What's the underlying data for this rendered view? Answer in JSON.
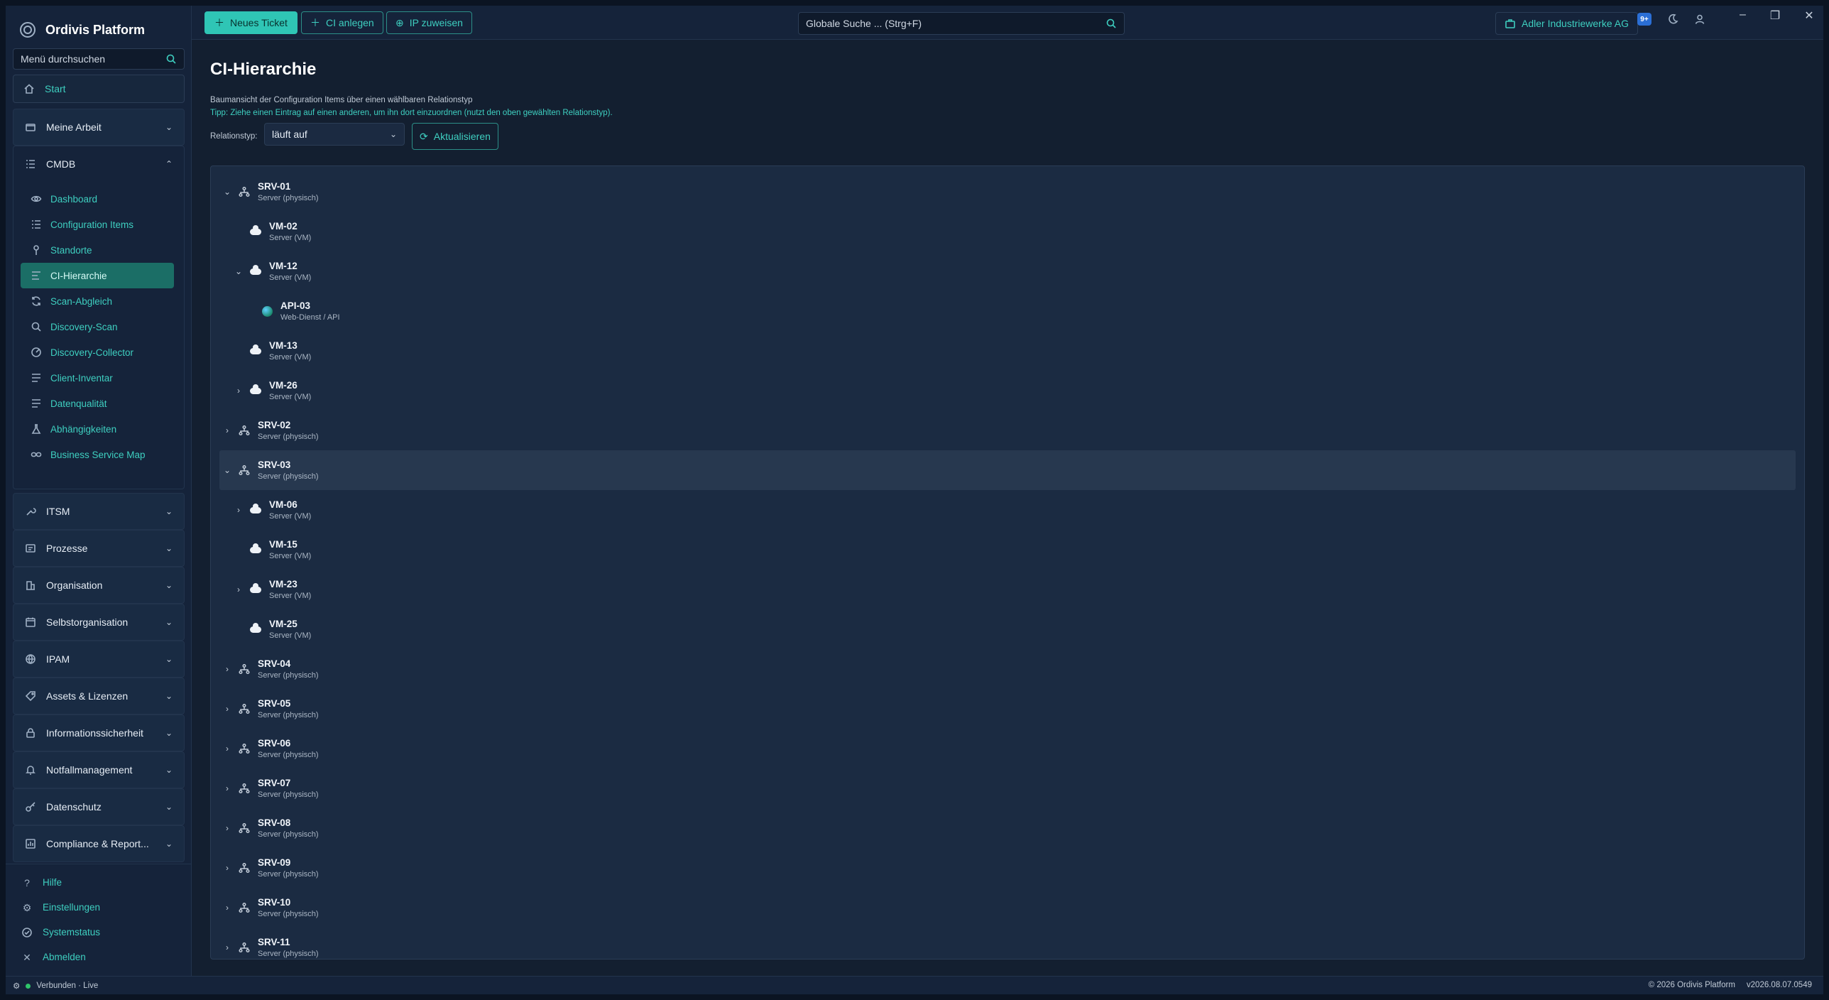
{
  "app": {
    "name": "Ordivis Platform"
  },
  "sidebar": {
    "search_placeholder": "Menü durchsuchen",
    "start_label": "Start",
    "groups": [
      {
        "label": "Meine Arbeit"
      },
      {
        "label": "CMDB",
        "items": [
          {
            "label": "Dashboard"
          },
          {
            "label": "Configuration Items"
          },
          {
            "label": "Standorte"
          },
          {
            "label": "CI-Hierarchie"
          },
          {
            "label": "Scan-Abgleich"
          },
          {
            "label": "Discovery-Scan"
          },
          {
            "label": "Discovery-Collector"
          },
          {
            "label": "Client-Inventar"
          },
          {
            "label": "Datenqualität"
          },
          {
            "label": "Abhängigkeiten"
          },
          {
            "label": "Business Service Map"
          }
        ]
      },
      {
        "label": "ITSM"
      },
      {
        "label": "Prozesse"
      },
      {
        "label": "Organisation"
      },
      {
        "label": "Selbstorganisation"
      },
      {
        "label": "IPAM"
      },
      {
        "label": "Assets & Lizenzen"
      },
      {
        "label": "Informationssicherheit"
      },
      {
        "label": "Notfallmanagement"
      },
      {
        "label": "Datenschutz"
      },
      {
        "label": "Compliance & Report..."
      }
    ],
    "footer": [
      {
        "label": "Hilfe"
      },
      {
        "label": "Einstellungen"
      },
      {
        "label": "Systemstatus"
      },
      {
        "label": "Abmelden"
      }
    ]
  },
  "topbar": {
    "new_ticket": "Neues Ticket",
    "create_ci": "CI anlegen",
    "assign_ip": "IP zuweisen",
    "search_placeholder": "Globale Suche ... (Strg+F)",
    "tenant": "Adler Industriewerke AG",
    "badge": "9+"
  },
  "main": {
    "title": "CI-Hierarchie",
    "description": "Baumansicht der Configuration Items über einen wählbaren Relationstyp",
    "tip": "Tipp: Ziehe einen Eintrag auf einen anderen, um ihn dort einzuordnen (nutzt den oben gewählten Relationstyp).",
    "relation_label": "Relationstyp:",
    "relation_value": "läuft auf",
    "refresh_label": "Aktualisieren"
  },
  "tree": [
    {
      "name": "SRV-01",
      "type": "Server (physisch)",
      "level": 0,
      "toggle": "open",
      "icon": "server"
    },
    {
      "name": "VM-02",
      "type": "Server (VM)",
      "level": 1,
      "toggle": "none",
      "icon": "cloud"
    },
    {
      "name": "VM-12",
      "type": "Server (VM)",
      "level": 1,
      "toggle": "open",
      "icon": "cloud"
    },
    {
      "name": "API-03",
      "type": "Web-Dienst / API",
      "level": 2,
      "toggle": "none",
      "icon": "globe"
    },
    {
      "name": "VM-13",
      "type": "Server (VM)",
      "level": 1,
      "toggle": "none",
      "icon": "cloud"
    },
    {
      "name": "VM-26",
      "type": "Server (VM)",
      "level": 1,
      "toggle": "closed",
      "icon": "cloud"
    },
    {
      "name": "SRV-02",
      "type": "Server (physisch)",
      "level": 0,
      "toggle": "closed",
      "icon": "server"
    },
    {
      "name": "SRV-03",
      "type": "Server (physisch)",
      "level": 0,
      "toggle": "open",
      "icon": "server",
      "hover": true
    },
    {
      "name": "VM-06",
      "type": "Server (VM)",
      "level": 1,
      "toggle": "closed",
      "icon": "cloud"
    },
    {
      "name": "VM-15",
      "type": "Server (VM)",
      "level": 1,
      "toggle": "none",
      "icon": "cloud"
    },
    {
      "name": "VM-23",
      "type": "Server (VM)",
      "level": 1,
      "toggle": "closed",
      "icon": "cloud"
    },
    {
      "name": "VM-25",
      "type": "Server (VM)",
      "level": 1,
      "toggle": "none",
      "icon": "cloud"
    },
    {
      "name": "SRV-04",
      "type": "Server (physisch)",
      "level": 0,
      "toggle": "closed",
      "icon": "server"
    },
    {
      "name": "SRV-05",
      "type": "Server (physisch)",
      "level": 0,
      "toggle": "closed",
      "icon": "server"
    },
    {
      "name": "SRV-06",
      "type": "Server (physisch)",
      "level": 0,
      "toggle": "closed",
      "icon": "server"
    },
    {
      "name": "SRV-07",
      "type": "Server (physisch)",
      "level": 0,
      "toggle": "closed",
      "icon": "server"
    },
    {
      "name": "SRV-08",
      "type": "Server (physisch)",
      "level": 0,
      "toggle": "closed",
      "icon": "server"
    },
    {
      "name": "SRV-09",
      "type": "Server (physisch)",
      "level": 0,
      "toggle": "closed",
      "icon": "server"
    },
    {
      "name": "SRV-10",
      "type": "Server (physisch)",
      "level": 0,
      "toggle": "closed",
      "icon": "server"
    },
    {
      "name": "SRV-11",
      "type": "Server (physisch)",
      "level": 0,
      "toggle": "closed",
      "icon": "server"
    }
  ],
  "statusbar": {
    "connection": "Verbunden · Live",
    "copyright": "© 2026 Ordivis Platform",
    "version": "v2026.08.07.0549"
  },
  "colors": {
    "accent": "#2fc5b5",
    "active_item": "#1b6e66",
    "background": "#131f30"
  }
}
